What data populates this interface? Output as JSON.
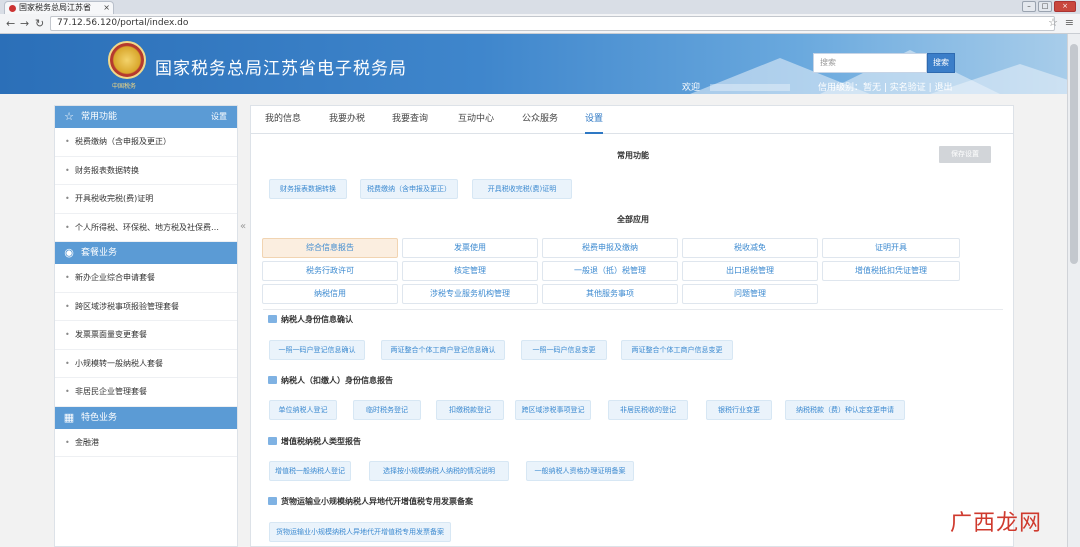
{
  "browser": {
    "tab_title": "国家税务总局江苏省",
    "tab_close": "×",
    "url": "77.12.56.120/portal/index.do",
    "win_min": "–",
    "win_max": "□",
    "win_close": "×"
  },
  "header": {
    "site_title": "国家税务总局江苏省电子税务局",
    "emblem_caption": "中国税务",
    "search_placeholder": "搜索",
    "search_button": "搜索",
    "welcome": "欢迎",
    "links": "信用级别：暂无 | 实名验证 | 退出"
  },
  "sidebar": {
    "sections": [
      {
        "title": "常用功能",
        "setting": "设置",
        "icon": "star-icon",
        "items": [
          "税费缴纳（含申报及更正）",
          "财务报表数据转换",
          "开具税收完税(费)证明",
          "个人所得税、环保税、地方税及社保费…"
        ]
      },
      {
        "title": "套餐业务",
        "icon": "package-icon",
        "items": [
          "新办企业综合申请套餐",
          "跨区域涉税事项报验管理套餐",
          "发票票面量变更套餐",
          "小规模转一般纳税人套餐",
          "非居民企业管理套餐"
        ]
      },
      {
        "title": "特色业务",
        "icon": "grid-icon",
        "items": [
          "金融港"
        ]
      }
    ]
  },
  "main": {
    "tabs": [
      "我的信息",
      "我要办税",
      "我要查询",
      "互动中心",
      "公众服务",
      "设置"
    ],
    "active_tab": 5,
    "common_title": "常用功能",
    "save_button": "保存设置",
    "common_items": [
      "财务报表数据转换",
      "税费缴纳（含申报及更正）",
      "开具税收完税(费)证明"
    ],
    "all_title": "全部应用",
    "grid": [
      "综合信息报告",
      "发票使用",
      "税费申报及缴纳",
      "税收减免",
      "证明开具",
      "税务行政许可",
      "核定管理",
      "一般退（抵）税管理",
      "出口退税管理",
      "增值税抵扣凭证管理",
      "纳税信用",
      "涉税专业服务机构管理",
      "其他服务事项",
      "问题管理"
    ],
    "groups": [
      {
        "title": "纳税人身份信息确认",
        "items": [
          "一照一码户登记信息确认",
          "两证整合个体工商户登记信息确认",
          "一照一码户信息变更",
          "两证整合个体工商户信息变更"
        ]
      },
      {
        "title": "纳税人（扣缴人）身份信息报告",
        "items": [
          "单位纳税人登记",
          "临时税务登记",
          "扣缴税款登记",
          "跨区域涉税事项登记",
          "非居民税收的登记",
          "银税行业变更",
          "纳税税款（费）种认定变更申请"
        ]
      },
      {
        "title": "增值税纳税人类型报告",
        "items": [
          "增值税一般纳税人登记",
          "选择按小规模纳税人纳税的情况说明",
          "一般纳税人资格办理证明备案"
        ]
      },
      {
        "title": "货物运输业小规模纳税人异地代开增值税专用发票备案",
        "items": [
          "货物运输业小规模纳税人异地代开增值税专用发票备案"
        ]
      }
    ]
  },
  "watermark": "广西龙网"
}
